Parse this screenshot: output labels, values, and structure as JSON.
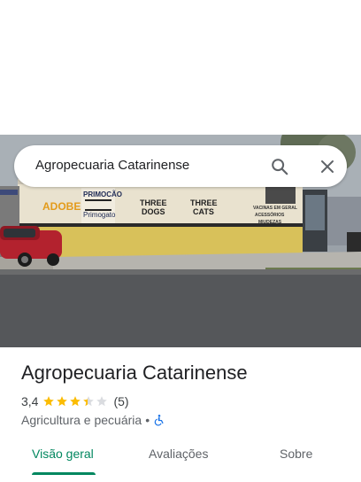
{
  "search": {
    "query": "Agropecuaria Catarinense",
    "search_icon": "search-icon",
    "close_icon": "close-icon"
  },
  "photo": {
    "signs": {
      "adobe": "ADOBE",
      "primocao": "PRIMOCÃO",
      "primogato": "Primogato",
      "three_dogs_1": "THREE",
      "three_dogs_2": "DOGS",
      "three_cats_1": "THREE",
      "three_cats_2": "CATS",
      "vacinas_1": "VACINAS EM GERAL",
      "vacinas_2": "ACESSÓRIOS",
      "vacinas_3": "MIUDEZAS"
    }
  },
  "place": {
    "name": "Agropecuaria Catarinense",
    "rating": "3,4",
    "rating_value": 3.4,
    "reviews": "(5)",
    "category": "Agricultura e pecuária",
    "separator": "•",
    "accessibility_icon": "wheelchair-icon"
  },
  "tabs": {
    "overview": "Visão geral",
    "reviews": "Avaliações",
    "about": "Sobre",
    "active": "overview"
  },
  "colors": {
    "accent": "#01875f",
    "star": "#fbbc04",
    "star_empty": "#dadce0",
    "accessibility": "#1a73e8"
  }
}
